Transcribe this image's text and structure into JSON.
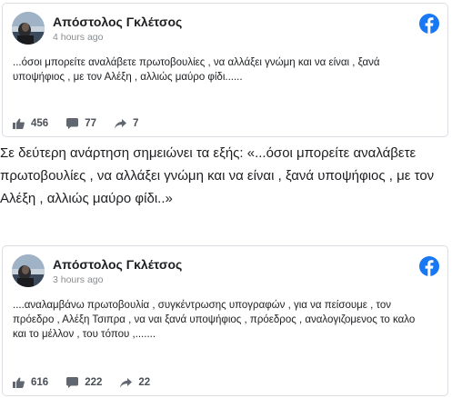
{
  "posts": [
    {
      "author": "Απόστολος Γκλέτσος",
      "time": "4 hours ago",
      "text": "...όσοι μπορείτε αναλάβετε πρωτοβουλίες , να αλλάξει γνώμη και να είναι , ξανά υποψήφιος , με τον Αλέξη , αλλιώς μαύρο φίδι......",
      "likes": "456",
      "comments": "77",
      "shares": "7"
    },
    {
      "author": "Απόστολος Γκλέτσος",
      "time": "3 hours ago",
      "text": "....αναλαμβάνω πρωτοβουλία , συγκέντρωσης υπογραφών , για να πείσουμε , τον πρόεδρο , Αλέξη Τσιπρα , να ναι ξανά υποψήφιος , πρόεδρος , αναλογιζομενος το καλο και το μέλλον , του τόπου ,.......",
      "likes": "616",
      "comments": "222",
      "shares": "22"
    }
  ],
  "caption": "Σε δεύτερη ανάρτηση σημειώνει τα εξής: «...όσοι μπορείτε αναλάβετε πρωτοβουλίες , να αλλάξει γνώμη και να είναι , ξανά υποψήφιος , με τον Αλέξη , αλλιώς μαύρο φίδι..»",
  "colors": {
    "facebook_blue": "#1877f2",
    "icon_gray": "#606770"
  }
}
